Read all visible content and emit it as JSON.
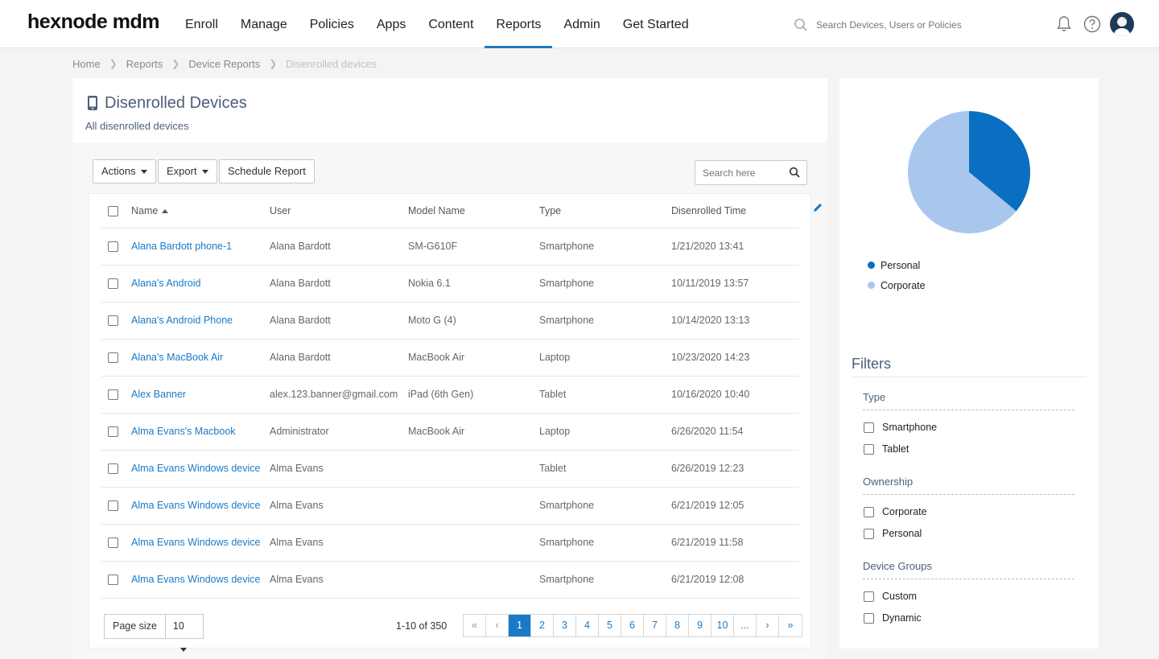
{
  "brand": {
    "logo": "hexnode mdm"
  },
  "nav": [
    "Enroll",
    "Manage",
    "Policies",
    "Apps",
    "Content",
    "Reports",
    "Admin",
    "Get Started"
  ],
  "nav_active": "Reports",
  "search": {
    "placeholder": "Search Devices, Users or Policies"
  },
  "icons": [
    "search-icon",
    "bell-icon",
    "help-icon",
    "avatar",
    "device-icon",
    "pencil-icon"
  ],
  "breadcrumb": [
    "Home",
    "Reports",
    "Device Reports",
    "Disenrolled devices"
  ],
  "page": {
    "title": "Disenrolled Devices",
    "subtitle": "All disenrolled devices"
  },
  "toolbar": {
    "actions": "Actions",
    "export": "Export",
    "schedule": "Schedule Report",
    "search_placeholder": "Search here"
  },
  "table": {
    "columns": [
      "Name",
      "User",
      "Model Name",
      "Type",
      "Disenrolled Time"
    ],
    "rows": [
      [
        "Alana Bardott phone-1",
        "Alana Bardott",
        "SM-G610F",
        "Smartphone",
        "1/21/2020 13:41"
      ],
      [
        "Alana's Android",
        "Alana Bardott",
        "Nokia 6.1",
        "Smartphone",
        "10/11/2019 13:57"
      ],
      [
        "Alana's Android Phone",
        "Alana Bardott",
        "Moto G (4)",
        "Smartphone",
        "10/14/2020 13:13"
      ],
      [
        "Alana's MacBook Air",
        "Alana Bardott",
        "MacBook Air",
        "Laptop",
        "10/23/2020 14:23"
      ],
      [
        "Alex Banner",
        "alex.123.banner@gmail.com",
        "iPad (6th Gen)",
        "Tablet",
        "10/16/2020 10:40"
      ],
      [
        "Alma Evans's Macbook",
        "Administrator",
        "MacBook Air",
        "Laptop",
        "6/26/2020 11:54"
      ],
      [
        "Alma Evans Windows device",
        "Alma Evans",
        "",
        "Tablet",
        "6/26/2019 12:23"
      ],
      [
        "Alma Evans Windows device",
        "Alma Evans",
        "",
        "Smartphone",
        "6/21/2019 12:05"
      ],
      [
        "Alma Evans Windows device",
        "Alma Evans",
        "",
        "Smartphone",
        "6/21/2019 11:58"
      ],
      [
        "Alma Evans Windows device",
        "Alma Evans",
        "",
        "Smartphone",
        "6/21/2019 12:08"
      ]
    ]
  },
  "pagination": {
    "page_size_label": "Page size",
    "page_size": "10",
    "count": "1-10 of 350",
    "pages": [
      "«",
      "‹",
      "1",
      "2",
      "3",
      "4",
      "5",
      "6",
      "7",
      "8",
      "9",
      "10",
      "...",
      "›",
      "»"
    ],
    "current": "1"
  },
  "ownership_chart": {
    "type": "pie",
    "slices": [
      {
        "label": "Personal",
        "value": 36,
        "color": "#0a6fc2"
      },
      {
        "label": "Corporate",
        "value": 64,
        "color": "#a9c7ec"
      }
    ]
  },
  "filters": {
    "title": "Filters",
    "groups": [
      {
        "title": "Type",
        "options": [
          "Smartphone",
          "Tablet"
        ]
      },
      {
        "title": "Ownership",
        "options": [
          "Corporate",
          "Personal"
        ]
      },
      {
        "title": "Device Groups",
        "options": [
          "Custom",
          "Dynamic"
        ]
      }
    ]
  },
  "colors": {
    "accent": "#1a7ac7",
    "heading": "#4d5e7a"
  }
}
